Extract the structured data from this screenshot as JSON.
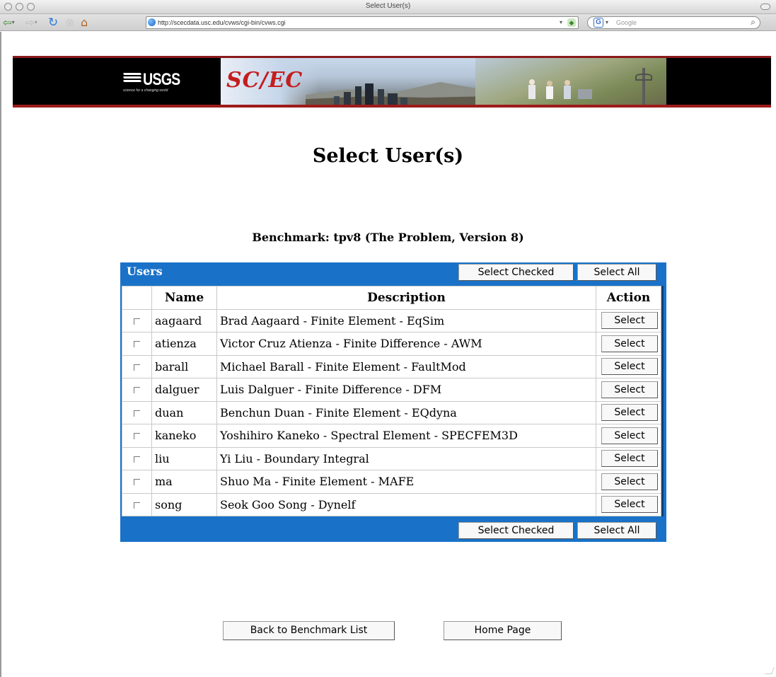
{
  "window": {
    "title": "Select User(s)"
  },
  "toolbar": {
    "url": "http://scecdata.usc.edu/cvws/cgi-bin/cvws.cgi",
    "search_placeholder": "Google"
  },
  "banner": {
    "usgs_text": "USGS",
    "usgs_tagline": "science for a changing world",
    "scec_text": "SC/EC"
  },
  "page": {
    "title": "Select User(s)",
    "subtitle": "Benchmark: tpv8 (The Problem, Version 8)"
  },
  "users_panel": {
    "label": "Users",
    "select_checked": "Select Checked",
    "select_all": "Select All",
    "columns": {
      "name": "Name",
      "description": "Description",
      "action": "Action"
    },
    "action_label": "Select",
    "rows": [
      {
        "name": "aagaard",
        "description": "Brad Aagaard - Finite Element - EqSim"
      },
      {
        "name": "atienza",
        "description": "Victor Cruz Atienza - Finite Difference - AWM"
      },
      {
        "name": "barall",
        "description": "Michael Barall - Finite Element - FaultMod"
      },
      {
        "name": "dalguer",
        "description": "Luis Dalguer - Finite Difference - DFM"
      },
      {
        "name": "duan",
        "description": "Benchun Duan - Finite Element - EQdyna"
      },
      {
        "name": "kaneko",
        "description": "Yoshihiro Kaneko - Spectral Element - SPECFEM3D"
      },
      {
        "name": "liu",
        "description": "Yi Liu - Boundary Integral"
      },
      {
        "name": "ma",
        "description": "Shuo Ma - Finite Element - MAFE"
      },
      {
        "name": "song",
        "description": "Seok Goo Song - Dynelf"
      }
    ]
  },
  "footer": {
    "back_label": "Back to Benchmark List",
    "home_label": "Home Page"
  },
  "colors": {
    "panel_blue": "#1a72c8",
    "banner_red": "#9e1b1b",
    "scec_red": "#c41e1e"
  },
  "icons": {
    "back": "back-arrow-icon",
    "forward": "forward-arrow-icon",
    "reload": "reload-icon",
    "stop": "stop-icon",
    "home": "home-icon",
    "site": "globe-icon",
    "rss": "rss-icon",
    "search": "magnifier-icon"
  }
}
